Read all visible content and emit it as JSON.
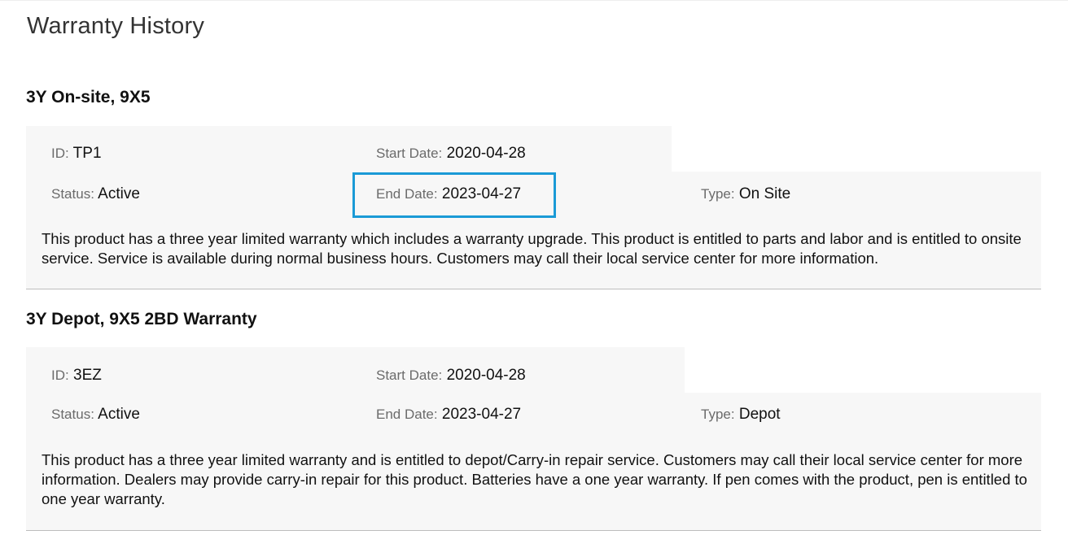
{
  "page": {
    "title": "Warranty History"
  },
  "labels": {
    "id": "ID",
    "start_date": "Start Date",
    "end_date": "End Date",
    "status": "Status",
    "type": "Type",
    "sep": ":"
  },
  "warranties": [
    {
      "title": "3Y On-site, 9X5",
      "id": "TP1",
      "start_date": "2020-04-28",
      "end_date": "2023-04-27",
      "status": "Active",
      "type": "On Site",
      "description": "This product has a three year limited warranty which includes a warranty upgrade. This product is entitled to parts and labor and is entitled to onsite service. Service is available during normal business hours. Customers may call their local service center for more information."
    },
    {
      "title": "3Y Depot, 9X5 2BD Warranty",
      "id": "3EZ",
      "start_date": "2020-04-28",
      "end_date": "2023-04-27",
      "status": "Active",
      "type": "Depot",
      "description": "This product has a three year limited warranty and is entitled to depot/Carry-in repair service. Customers may call their local service center for more information. Dealers may provide carry-in repair for this product. Batteries have a one year warranty. If pen comes with the product, pen is entitled to one year warranty."
    }
  ],
  "highlight": {
    "color": "#1a9ad6"
  }
}
